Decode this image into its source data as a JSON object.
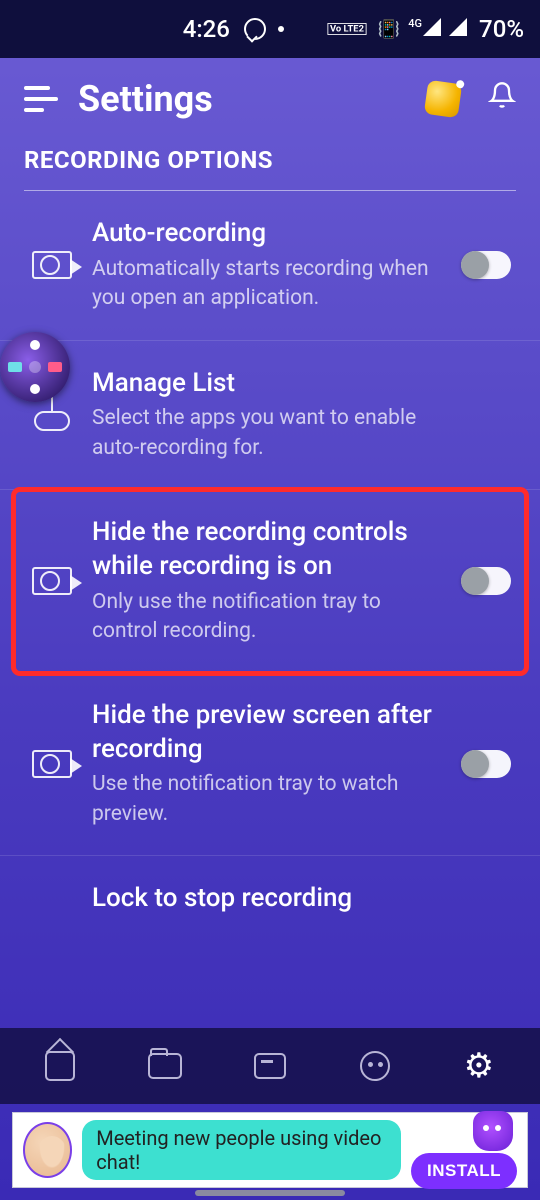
{
  "status": {
    "time": "4:26",
    "lte_label": "Vo LTE2",
    "net_label": "4G",
    "battery": "70%"
  },
  "header": {
    "title": "Settings"
  },
  "section": {
    "title": "RECORDING OPTIONS"
  },
  "rows": [
    {
      "title": "Auto-recording",
      "subtitle": "Automatically starts recording when you open an application.",
      "has_toggle": true,
      "toggle_on": false
    },
    {
      "title": "Manage List",
      "subtitle": "Select the apps you want to enable auto-recording for.",
      "has_toggle": false
    },
    {
      "title": "Hide the recording controls while recording is on",
      "subtitle": "Only use the notification tray to control recording.",
      "has_toggle": true,
      "toggle_on": false,
      "highlighted": true
    },
    {
      "title": "Hide the preview screen after recording",
      "subtitle": "Use the notification tray to watch preview.",
      "has_toggle": true,
      "toggle_on": false
    },
    {
      "title": "Lock to stop recording",
      "subtitle": "",
      "has_toggle": true,
      "toggle_on": false
    }
  ],
  "ad": {
    "text": "Meeting new people using video chat!",
    "cta": "INSTALL"
  }
}
